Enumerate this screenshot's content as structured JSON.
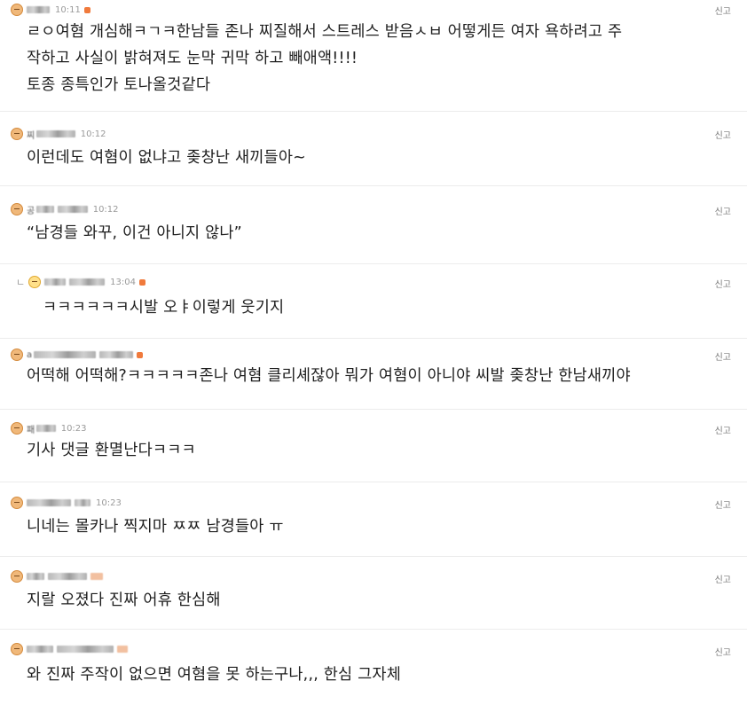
{
  "comments": [
    {
      "time": "10:11",
      "text": "ㄹㅇ여혐 개심해ㅋㄱㅋ한남들 존나 찌질해서 스트레스 받음ㅅㅂ 어떻게든 여자 욕하려고 주\n작하고 사실이 밝혀져도 눈막 귀막 하고 빼애액!!!!\n토종 종특인가 토나올것같다",
      "report": "신고"
    },
    {
      "nick": "찌",
      "time": "10:12",
      "text": "이런데도 여혐이 없냐고 좆창난 새끼들아~",
      "report": "신고"
    },
    {
      "nick": "공",
      "time": "10:12",
      "text": "“남경들 와꾸, 이건 아니지 않나”",
      "report": "신고"
    },
    {
      "reply": "ㄴ",
      "time": "13:04",
      "text": "ㅋㅋㅋㅋㅋㅋ시발 오ㅑ이렇게 웃기지",
      "report": "신고"
    },
    {
      "nick": "a",
      "text": "어떡해 어떡해?ㅋㅋㅋㅋㅋ존나 여혐 클리셰잖아 뭐가 여혐이 아니야 씨발 좆창난 한남새끼야",
      "report": "신고"
    },
    {
      "nick": "패",
      "time": "10:23",
      "text": "기사 댓글 환멸난다ㅋㅋㅋ",
      "report": "신고"
    },
    {
      "time": "10:23",
      "text": "니네는 몰카나 찍지마 ㅉㅉ 남경들아 ㅠ",
      "report": "신고"
    },
    {
      "text": "지랄 오졌다 진짜 어휴 한심해",
      "report": "신고"
    },
    {
      "text": "와 진짜 주작이 없으면 여혐을 못 하는구나,,, 한심 그자체",
      "report": "신고"
    }
  ]
}
